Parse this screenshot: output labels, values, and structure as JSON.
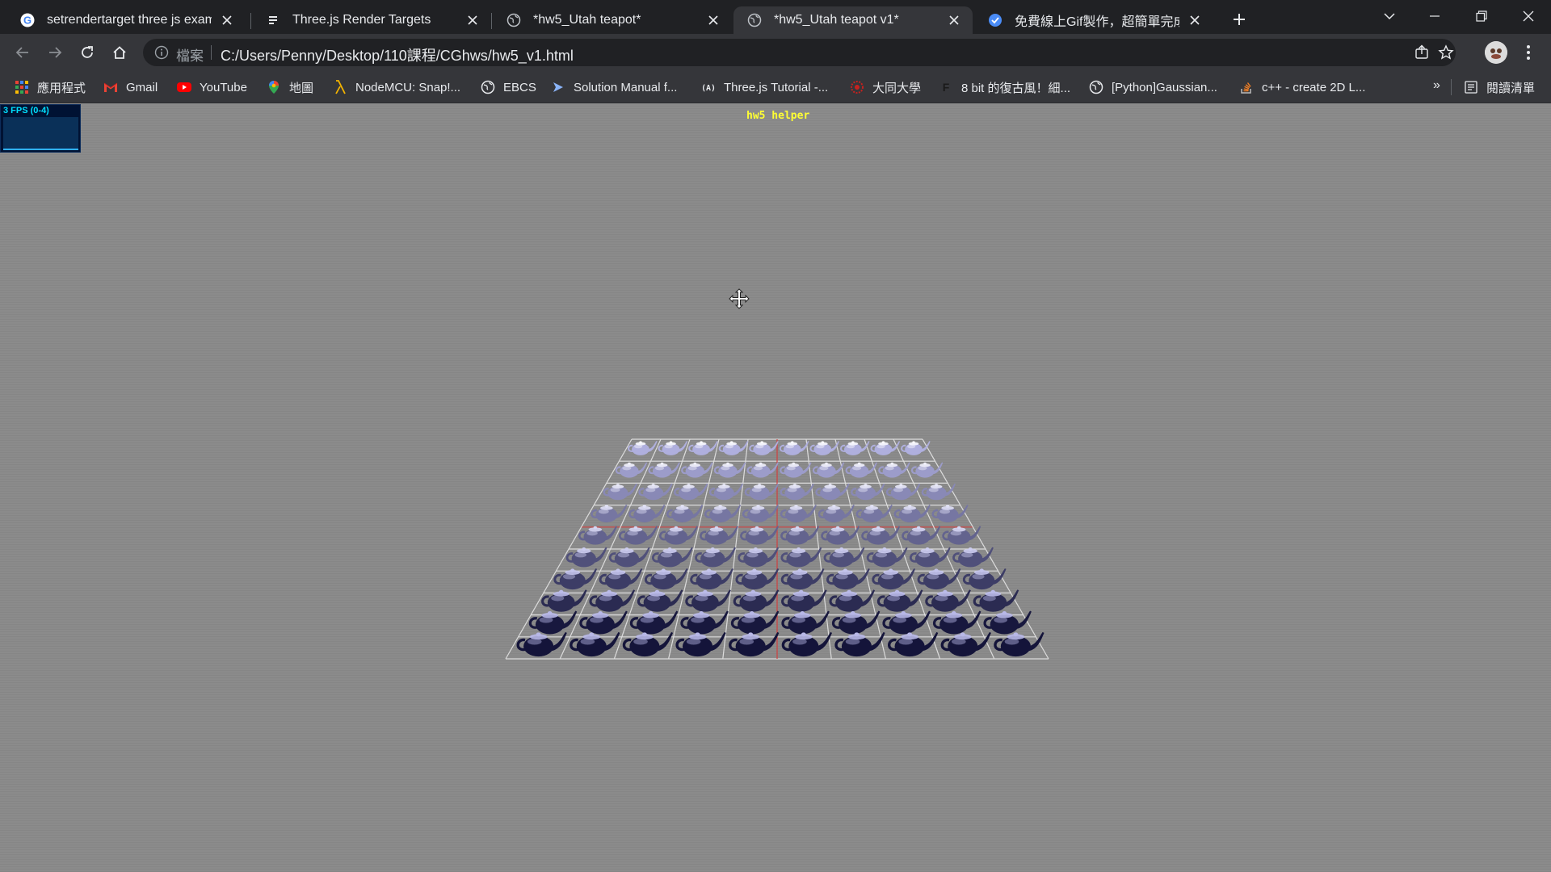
{
  "tabs": [
    {
      "title": "setrendertarget three js examp",
      "icon": "google-icon"
    },
    {
      "title": "Three.js Render Targets",
      "icon": "doc-icon"
    },
    {
      "title": "*hw5_Utah teapot*",
      "icon": "globe-icon"
    },
    {
      "title": "*hw5_Utah teapot v1*",
      "icon": "globe-icon",
      "active": true
    },
    {
      "title": "免費線上Gif製作，超簡單完成影",
      "icon": "gif-site-icon"
    }
  ],
  "address": {
    "scheme_label": "檔案",
    "url": "C:/Users/Penny/Desktop/110課程/CGhws/hw5_v1.html"
  },
  "bookmarks": [
    {
      "label": "應用程式",
      "icon": "apps-grid-icon"
    },
    {
      "label": "Gmail",
      "icon": "gmail-icon"
    },
    {
      "label": "YouTube",
      "icon": "youtube-icon"
    },
    {
      "label": "地圖",
      "icon": "maps-pin-icon"
    },
    {
      "label": "NodeMCU: Snap!...",
      "icon": "lambda-icon"
    },
    {
      "label": "EBCS",
      "icon": "globe-icon"
    },
    {
      "label": "Solution Manual f...",
      "icon": "arrow-site-icon"
    },
    {
      "label": "Three.js Tutorial -...",
      "icon": "threejs-icon"
    },
    {
      "label": "大同大學",
      "icon": "university-icon"
    },
    {
      "label": "8 bit 的復古風！細...",
      "icon": "f-icon"
    },
    {
      "label": "[Python]Gaussian...",
      "icon": "globe-icon"
    },
    {
      "label": "c++ - create 2D L...",
      "icon": "stackoverflow-icon"
    }
  ],
  "bookmarks_more": "»",
  "reading_list": "閱讀清單",
  "page": {
    "fps_label": "3 FPS (0-4)",
    "helper_title": "hw5 helper"
  },
  "colors": {
    "titlebar": "#202124",
    "toolbar": "#35363a",
    "page_bg": "#8b8b8b",
    "teapot_dark": "#14143a",
    "teapot_light": "#b8b8e8",
    "grid_line": "#dcdcdc",
    "helper_text": "#ffff33"
  },
  "scene": {
    "teapot_rows": 10,
    "teapot_cols": 10
  }
}
